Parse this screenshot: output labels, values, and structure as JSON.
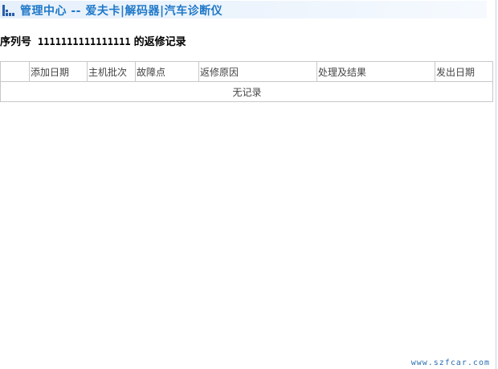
{
  "header": {
    "title": "管理中心 -- 爱夫卡|解码器|汽车诊断仪",
    "icon": "bar-chart-icon",
    "accent_color": "#1f78c8"
  },
  "serial": {
    "label": "序列号",
    "number": "1111111111111111",
    "suffix": "的返修记录"
  },
  "table": {
    "columns": [
      "",
      "添加日期",
      "主机批次",
      "故障点",
      "返修原因",
      "处理及结果",
      "发出日期"
    ],
    "empty_text": "无记录"
  },
  "footer": {
    "watermark": "www.szfcar.com"
  }
}
